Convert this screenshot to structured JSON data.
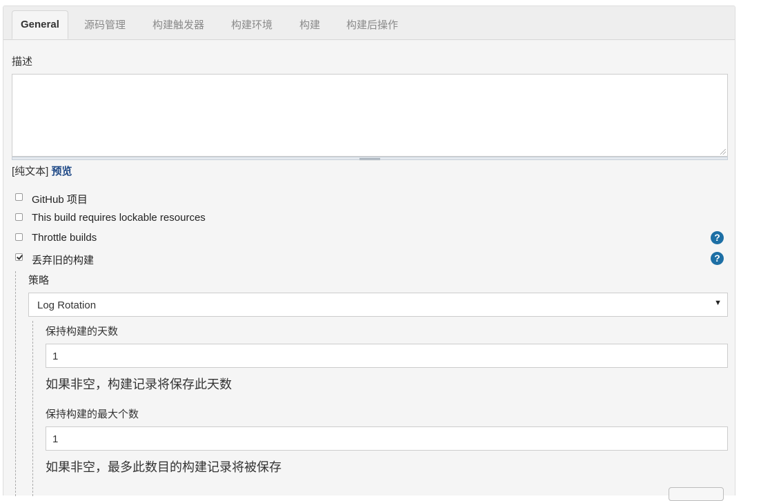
{
  "tabs": [
    {
      "label": "General"
    },
    {
      "label": "源码管理"
    },
    {
      "label": "构建触发器"
    },
    {
      "label": "构建环境"
    },
    {
      "label": "构建"
    },
    {
      "label": "构建后操作"
    }
  ],
  "description": {
    "label": "描述",
    "value": "",
    "format_prefix": "[纯文本]",
    "preview_label": "预览"
  },
  "options": {
    "github_project": {
      "label": "GitHub 项目",
      "checked": false
    },
    "lockable": {
      "label": "This build requires lockable resources",
      "checked": false
    },
    "throttle": {
      "label": "Throttle builds",
      "checked": false
    },
    "discard_old": {
      "label": "丢弃旧的构建",
      "checked": true
    }
  },
  "help_icon_text": "?",
  "strategy": {
    "label": "策略",
    "selected": "Log Rotation",
    "arrow": "▼"
  },
  "days_to_keep": {
    "label": "保持构建的天数",
    "value": "1",
    "hint": "如果非空，构建记录将保存此天数"
  },
  "max_builds": {
    "label": "保持构建的最大个数",
    "value": "1",
    "hint": "如果非空，最多此数目的构建记录将被保存"
  },
  "colors": {
    "link": "#204a87",
    "help_icon": "#1d6fa5",
    "panel_bg": "#f5f5f5"
  }
}
